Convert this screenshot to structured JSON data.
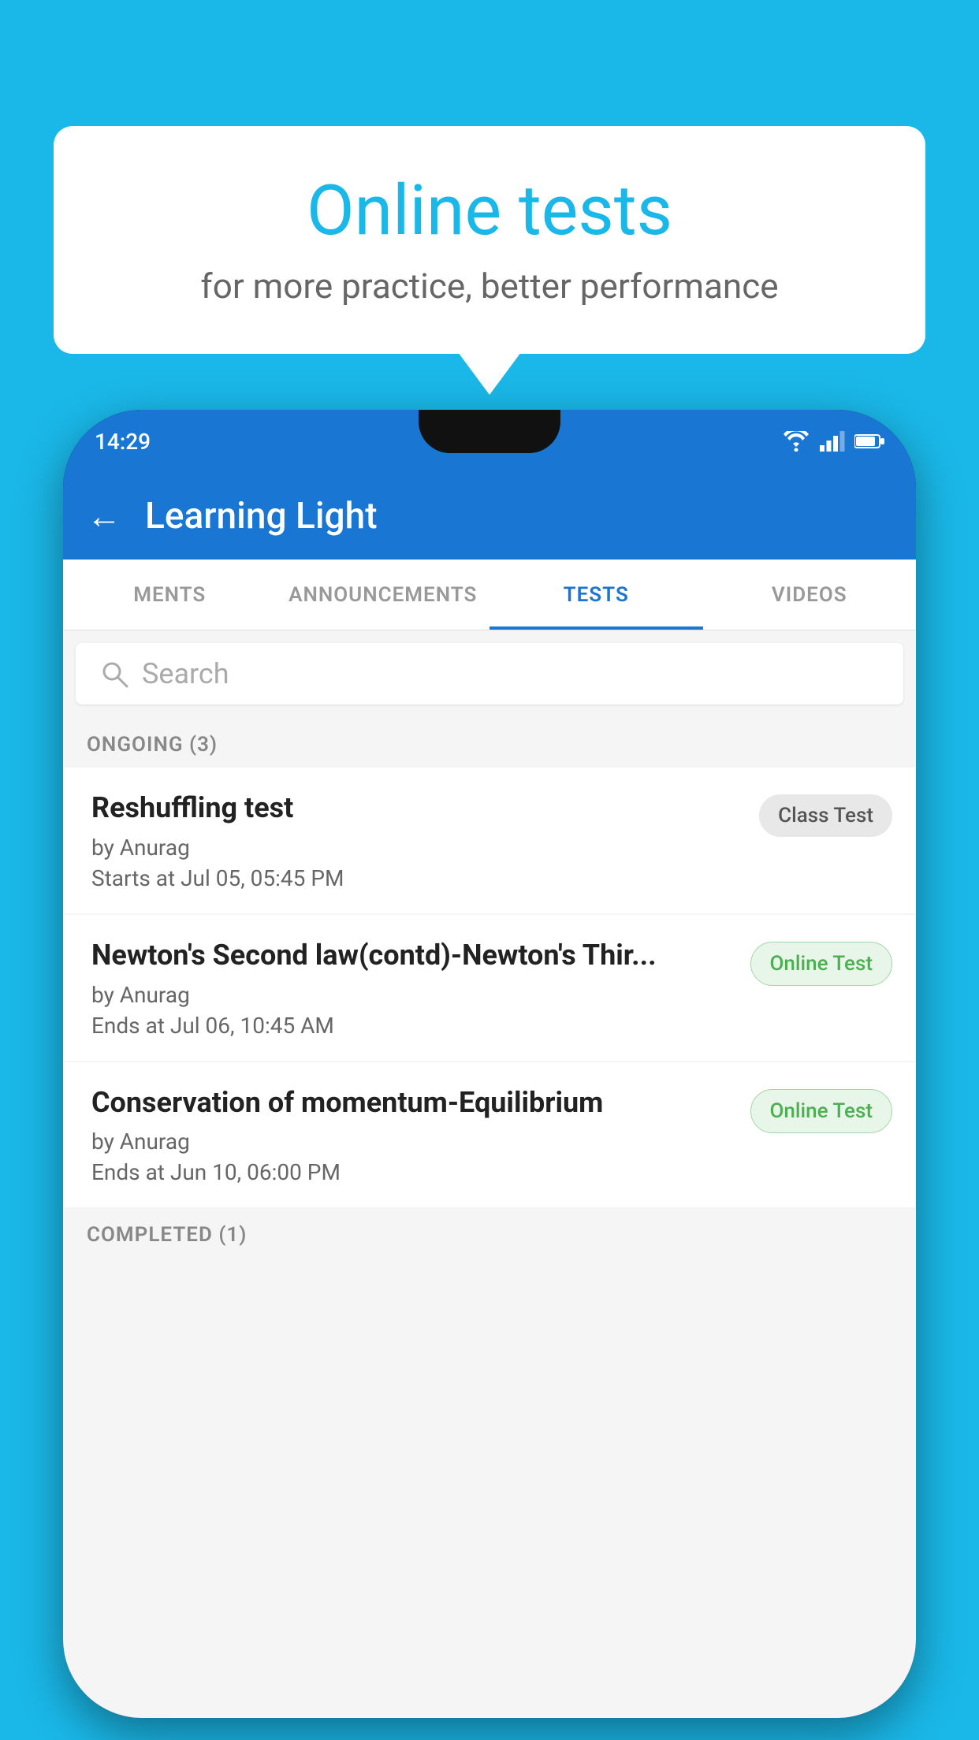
{
  "background_color": "#1ab8e8",
  "speech_bubble": {
    "title": "Online tests",
    "subtitle": "for more practice, better performance"
  },
  "phone": {
    "status_bar": {
      "time": "14:29",
      "icons": [
        "wifi",
        "signal",
        "battery"
      ]
    },
    "app_bar": {
      "back_label": "←",
      "title": "Learning Light"
    },
    "tabs": [
      {
        "label": "MENTS",
        "active": false
      },
      {
        "label": "ANNOUNCEMENTS",
        "active": false
      },
      {
        "label": "TESTS",
        "active": true
      },
      {
        "label": "VIDEOS",
        "active": false
      }
    ],
    "search": {
      "placeholder": "Search"
    },
    "ongoing_section": {
      "header": "ONGOING (3)",
      "tests": [
        {
          "title": "Reshuffling test",
          "author": "by Anurag",
          "date": "Starts at  Jul 05, 05:45 PM",
          "badge": "Class Test",
          "badge_type": "class"
        },
        {
          "title": "Newton's Second law(contd)-Newton's Thir...",
          "author": "by Anurag",
          "date": "Ends at  Jul 06, 10:45 AM",
          "badge": "Online Test",
          "badge_type": "online"
        },
        {
          "title": "Conservation of momentum-Equilibrium",
          "author": "by Anurag",
          "date": "Ends at  Jun 10, 06:00 PM",
          "badge": "Online Test",
          "badge_type": "online"
        }
      ]
    },
    "completed_section": {
      "header": "COMPLETED (1)"
    }
  }
}
